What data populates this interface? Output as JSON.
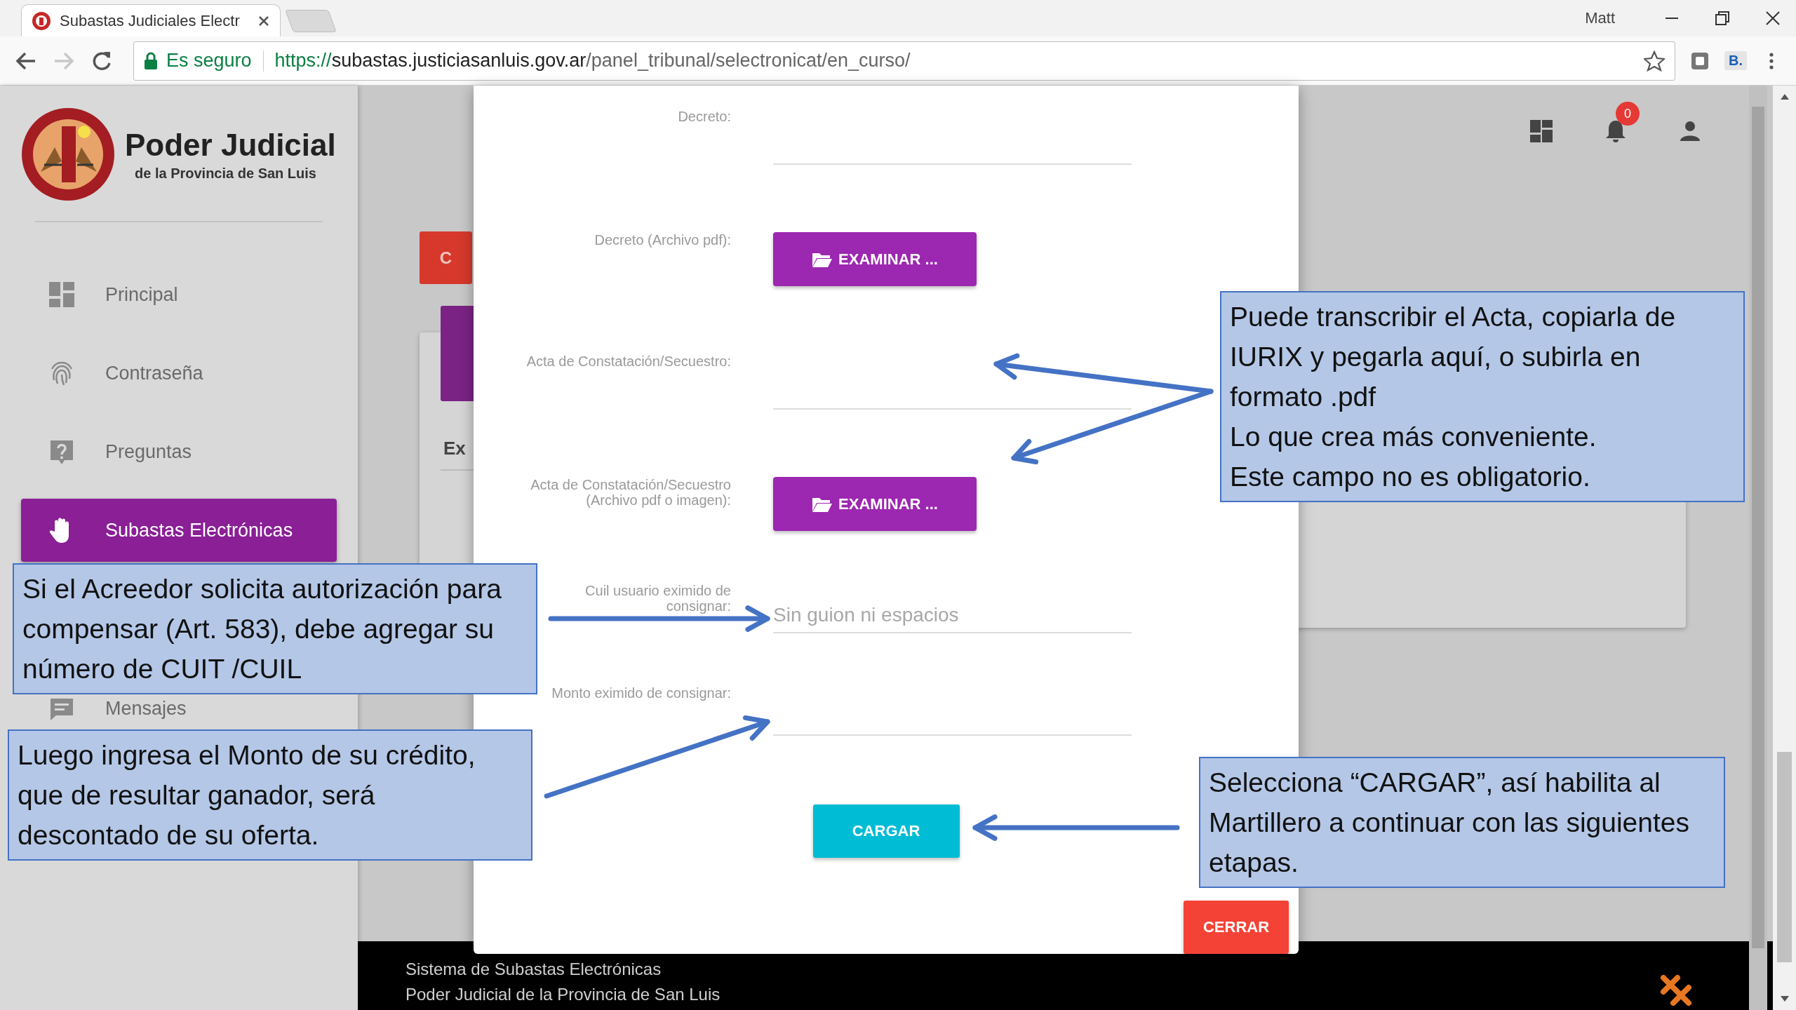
{
  "browser": {
    "tab_title": "Subastas Judiciales Electr",
    "user": "Matt",
    "security_label": "Es seguro",
    "url_scheme": "https://",
    "url_host": "subastas.justiciasanluis.gov.ar",
    "url_path": "/panel_tribunal/selectronicat/en_curso/",
    "extension_label": "B."
  },
  "sidebar": {
    "brand_title": "Poder Judicial",
    "brand_subtitle": "de la Provincia de San Luis",
    "items": [
      {
        "kind": "dashboard",
        "label": "Principal",
        "selected": false
      },
      {
        "kind": "fingerprint",
        "label": "Contraseña",
        "selected": false
      },
      {
        "kind": "help",
        "label": "Preguntas",
        "selected": false
      },
      {
        "kind": "hand",
        "label": "Subastas Electrónicas",
        "selected": true
      },
      {
        "kind": "message",
        "label": "Mensajes",
        "selected": false
      }
    ]
  },
  "header": {
    "notification_count": "0"
  },
  "background": {
    "button_label": "C",
    "tab_label": "Ex"
  },
  "modal": {
    "fields": [
      {
        "kind": "textarea",
        "label": "Decreto:"
      },
      {
        "kind": "file",
        "label": "Decreto (Archivo pdf):",
        "button": "EXAMINAR ..."
      },
      {
        "kind": "textarea",
        "label": "Acta de Constatación/Secuestro:"
      },
      {
        "kind": "file",
        "label": "Acta de Constatación/Secuestro\n(Archivo pdf o imagen):",
        "button": "EXAMINAR ..."
      },
      {
        "kind": "input",
        "label": "Cuil usuario eximido de\nconsignar:",
        "placeholder": "Sin guion ni espacios"
      },
      {
        "kind": "input",
        "label": "Monto eximido de consignar:"
      }
    ],
    "submit": "CARGAR",
    "close": "CERRAR"
  },
  "footer": {
    "lines": [
      "Sistema de Subastas Electrónicas",
      "Poder Judicial de la Provincia de San Luis"
    ]
  },
  "callouts": [
    {
      "paragraphs": [
        "Puede transcribir el Acta, copiarla de IURIX y pegarla aquí, o subirla en formato .pdf",
        "Lo que crea más conveniente.",
        "Este campo no es obligatorio."
      ]
    },
    {
      "paragraphs": [
        "Si el Acreedor solicita autorización para compensar (Art. 583), debe agregar su número de CUIT /CUIL"
      ]
    },
    {
      "paragraphs": [
        "Luego ingresa el Monto de su crédito, que de resultar ganador, será descontado de su oferta."
      ]
    },
    {
      "paragraphs": [
        "Selecciona “CARGAR”, así habilita al Martillero a continuar con las siguientes etapas."
      ]
    }
  ]
}
